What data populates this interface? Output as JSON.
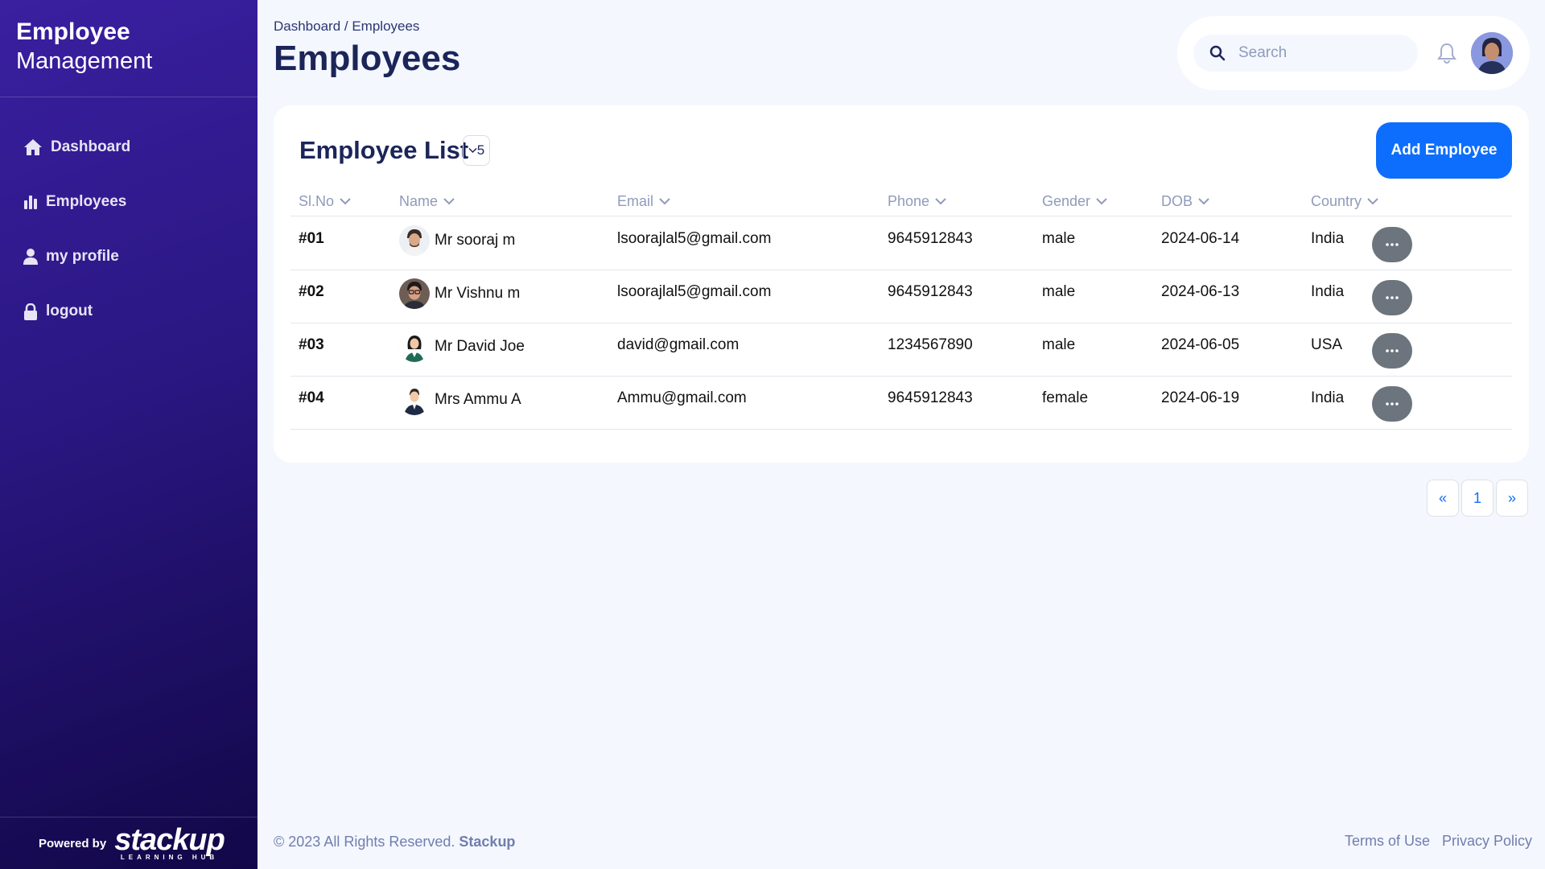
{
  "brand": {
    "line1": "Employee",
    "line2": "Management"
  },
  "sidebar": {
    "items": [
      {
        "label": "Dashboard",
        "icon": "home-icon"
      },
      {
        "label": "Employees",
        "icon": "bar-chart-icon"
      },
      {
        "label": "my profile",
        "icon": "user-icon"
      },
      {
        "label": "logout",
        "icon": "lock-icon"
      }
    ],
    "powered_by": "Powered by",
    "logo_text": "stackup",
    "logo_sub": "LEARNING HUB"
  },
  "header": {
    "breadcrumb": "Dashboard / Employees",
    "title": "Employees",
    "search_placeholder": "Search"
  },
  "employee_list": {
    "title": "Employee List",
    "count": "5",
    "add_button": "Add Employee",
    "columns": [
      "Sl.No",
      "Name",
      "Email",
      "Phone",
      "Gender",
      "DOB",
      "Country"
    ],
    "rows": [
      {
        "slno": "#01",
        "name": "Mr sooraj m",
        "email": "lsoorajlal5@gmail.com",
        "phone": "9645912843",
        "gender": "male",
        "dob": "2024-06-14",
        "country": "India"
      },
      {
        "slno": "#02",
        "name": "Mr Vishnu m",
        "email": "lsoorajlal5@gmail.com",
        "phone": "9645912843",
        "gender": "male",
        "dob": "2024-06-13",
        "country": "India"
      },
      {
        "slno": "#03",
        "name": "Mr David Joe",
        "email": "david@gmail.com",
        "phone": "1234567890",
        "gender": "male",
        "dob": "2024-06-05",
        "country": "USA"
      },
      {
        "slno": "#04",
        "name": "Mrs Ammu A",
        "email": "Ammu@gmail.com",
        "phone": "9645912843",
        "gender": "female",
        "dob": "2024-06-19",
        "country": "India"
      }
    ]
  },
  "pagination": {
    "prev": "«",
    "page": "1",
    "next": "»"
  },
  "footer": {
    "copyright": "© 2023 All Rights Reserved.",
    "brand": "Stackup",
    "terms": "Terms of Use",
    "privacy": "Privacy Policy"
  },
  "colors": {
    "primary": "#0d6efd",
    "sidebar_start": "#3a1fa0",
    "sidebar_end": "#120748",
    "title": "#1b2559",
    "muted": "#8f9bba",
    "action": "#6c757d"
  }
}
